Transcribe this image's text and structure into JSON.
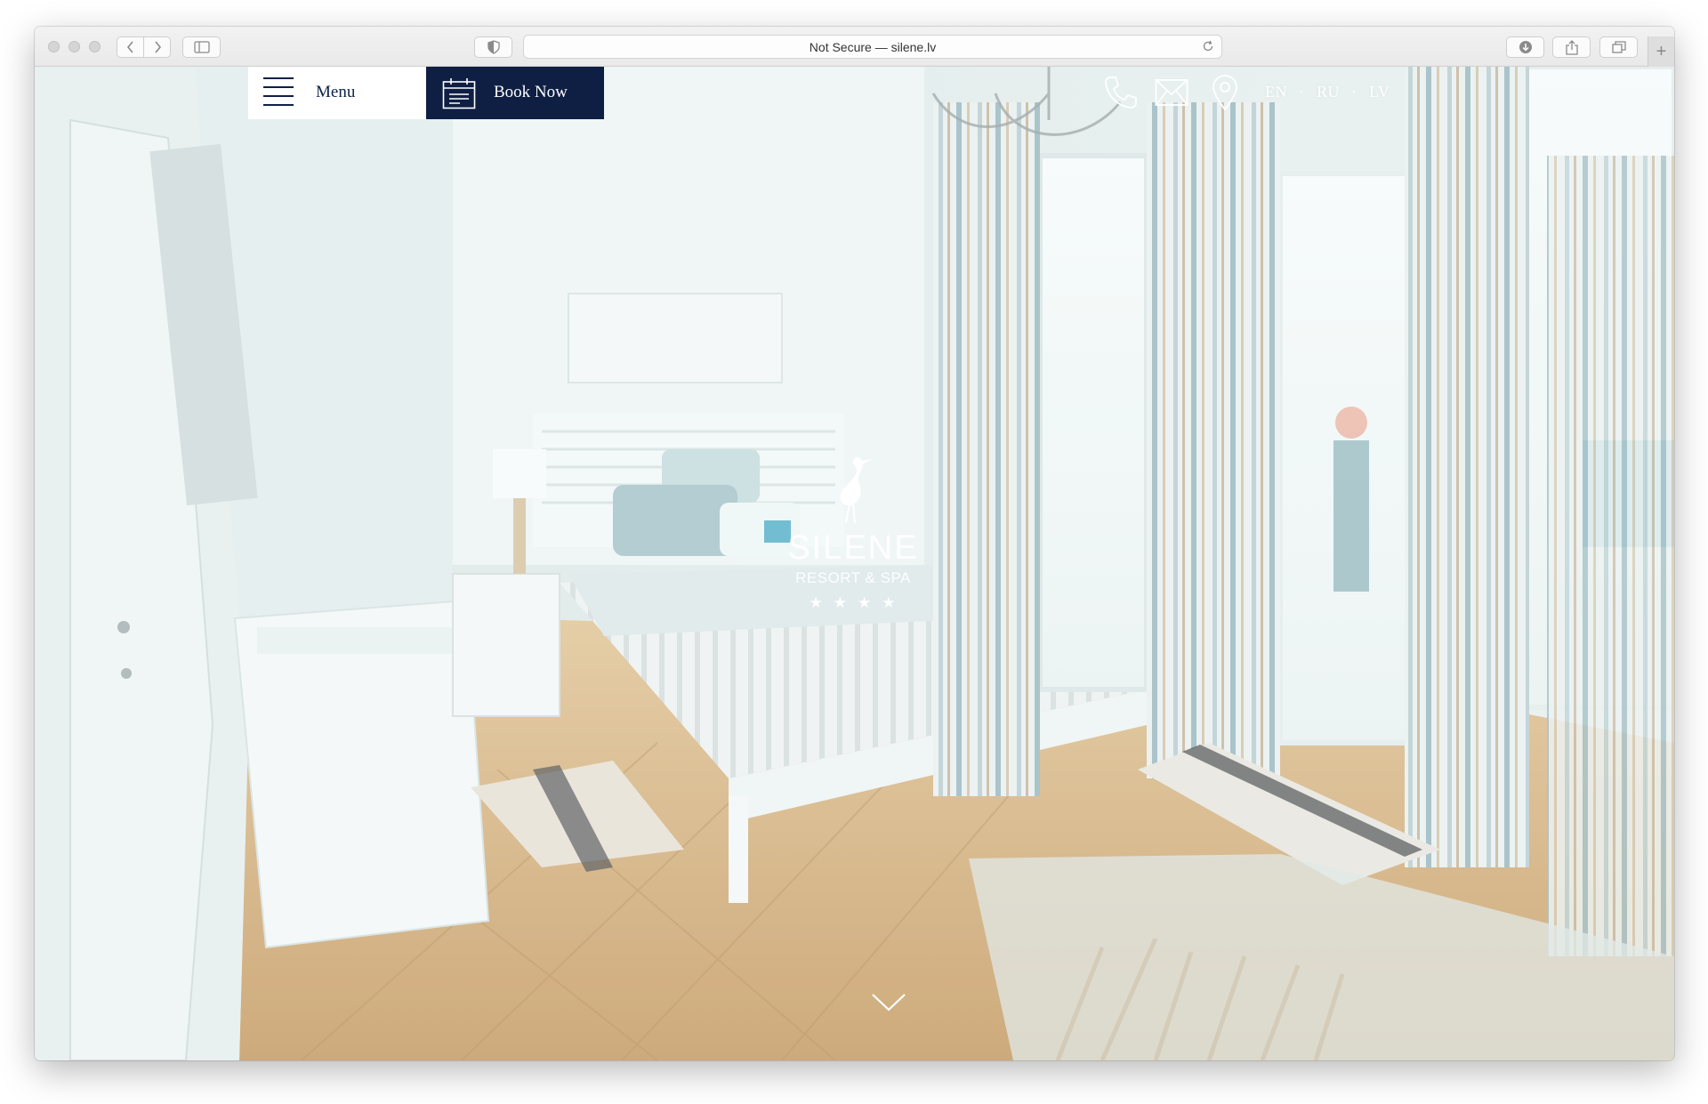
{
  "browser": {
    "address": "Not Secure — silene.lv"
  },
  "header": {
    "menu_label": "Menu",
    "book_label": "Book Now",
    "icons": [
      "phone-icon",
      "mail-icon",
      "location-pin-icon"
    ],
    "languages": [
      "EN",
      "RU",
      "LV"
    ],
    "separator": "·"
  },
  "logo": {
    "name": "SILENE",
    "subtitle": "RESORT & SPA",
    "stars": "★★★★"
  },
  "colors": {
    "navy": "#0f1f44",
    "white": "#ffffff"
  }
}
